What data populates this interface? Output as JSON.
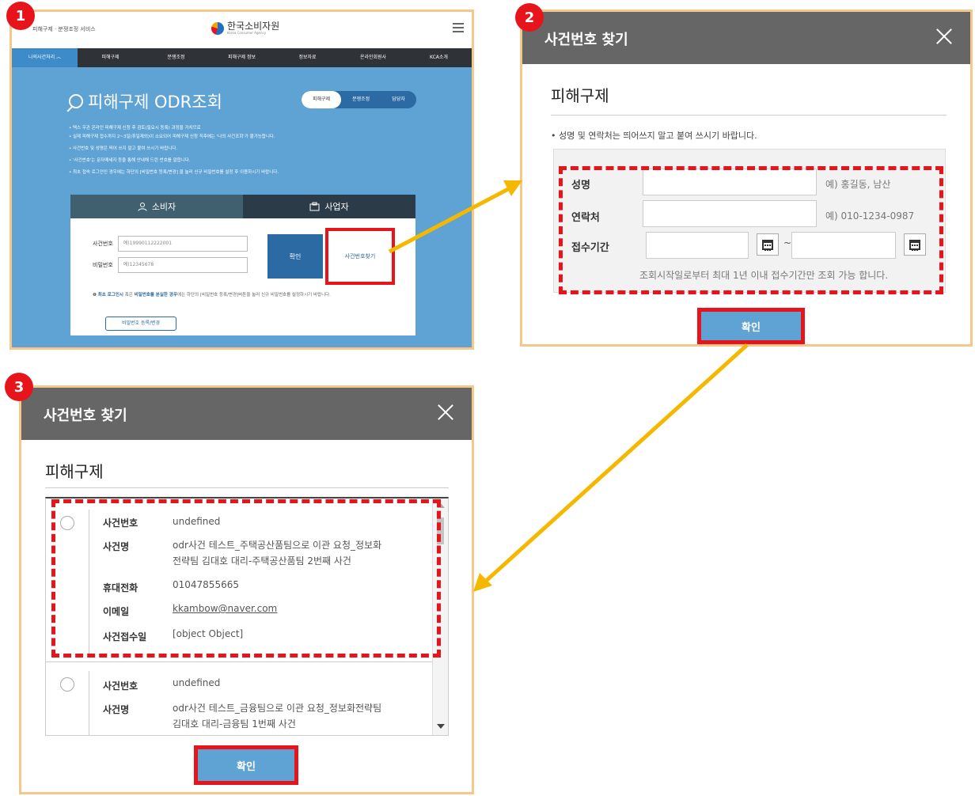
{
  "badges": [
    "1",
    "2",
    "3"
  ],
  "panel1": {
    "service_name": "피해구제 · 분쟁조정 서비스",
    "logo_name": "한국소비자원",
    "logo_sub": "Korea Consumer Agency",
    "nav": [
      "나의사건처리 ︿",
      "피해구제",
      "분쟁조정",
      "피해구제 정보",
      "정보자료",
      "온라인회원사",
      "KCA소개"
    ],
    "title": "피해구제 ODR조회",
    "segment": [
      "피해구제",
      "분쟁조정",
      "담당자"
    ],
    "notes": [
      "택스 우관 온라인 피해구제 신청 후 검토(필요시 등록) 과정을 거치므로",
      "실제 피해구제 접수까지 2~3일(휴일제외)이 소요되어 피해구제 신청 직후에는 '나의 사건조회'가 불가능합니다.",
      "사건번호 및 성명은 띄어 쓰지 말고 붙여 쓰시기 바랍니다.",
      "'사건번호'는 문자메세지 등을 통해 안내해 드린 번호를 말합니다.",
      "최초 접속 로그인인 경우에는 하단의 [비밀번호 등록/변경] 을 눌러 신규 비밀번호를 설정 후 이용하시기 바랍니다."
    ],
    "tab_consumer": "소비자",
    "tab_business": "사업자",
    "case_label": "사건번호",
    "case_placeholder": "예)19990112222001",
    "pw_label": "비밀번호",
    "pw_placeholder": "예)12345678",
    "confirm": "확인",
    "find_case": "사건번호찾기",
    "info_pre": "최초 로그인시",
    "info_mid": " 혹은 ",
    "info_bold": "비밀번호를 분실한 경우",
    "info_post": "에는 하단의 [비밀번호 등록/변경]버튼을 눌러 신규 비밀번호를 설정하시기 바랍니다.",
    "register_pw": "비밀번호 등록/변경"
  },
  "panel2": {
    "title": "사건번호 찾기",
    "section": "피해구제",
    "note": "• 성명 및 연락처는 띄어쓰지 말고 붙여 쓰시기 바랍니다.",
    "name_label": "성명",
    "name_example": "예) 홍길동, 남산",
    "phone_label": "연락처",
    "phone_example": "예) 010-1234-0987",
    "period_label": "접수기간",
    "tilde": "~",
    "range_note": "조회시작일로부터 최대 1년 이내 접수기간만 조회 가능 합니다.",
    "confirm": "확인"
  },
  "panel3": {
    "title": "사건번호 찾기",
    "section": "피해구제",
    "items": [
      {
        "case_no_label": "사건번호",
        "case_no": "undefined",
        "case_name_label": "사건명",
        "case_name_1": "odr사건 테스트_주택공산품팀으로 이관 요청_정보화",
        "case_name_2": "전략팀 김대호 대리-주택공산품팀 2번째 사건",
        "phone_label": "휴대전화",
        "phone": "01047855665",
        "email_label": "이메일",
        "email": "kkambow@naver.com",
        "date_label": "사건접수일",
        "date": "[object Object]"
      },
      {
        "case_no_label": "사건번호",
        "case_no": "undefined",
        "case_name_label": "사건명",
        "case_name_1": "odr사건 테스트_금융팀으로 이관 요청_정보화전략팀",
        "case_name_2": "김대호 대리-금융팀 1번째 사건"
      }
    ],
    "confirm": "확인"
  },
  "colors": {
    "highlight": "#e8141b",
    "arrow": "#f5b800",
    "header": "#666666",
    "primary": "#5fa2d4"
  }
}
